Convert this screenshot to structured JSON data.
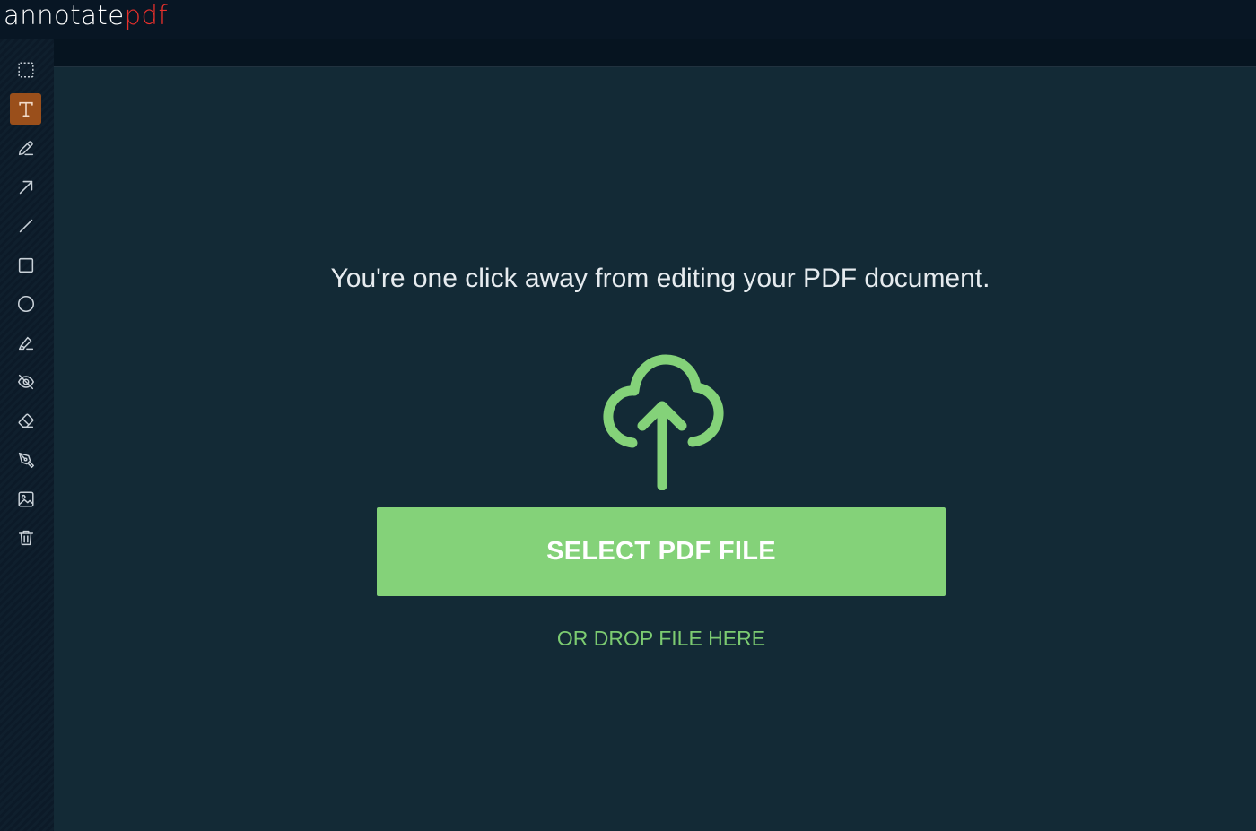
{
  "app": {
    "logo_part1": "annotate",
    "logo_part2": "pdf"
  },
  "colors": {
    "accent_green": "#84d279",
    "logo_red": "#e8302c",
    "active_tool": "#9a4f1b",
    "background": "#132a36"
  },
  "toolbar": {
    "tools": [
      {
        "icon": "select-region-icon",
        "active": false
      },
      {
        "icon": "text-icon",
        "active": true
      },
      {
        "icon": "pencil-icon",
        "active": false
      },
      {
        "icon": "arrow-icon",
        "active": false
      },
      {
        "icon": "line-icon",
        "active": false
      },
      {
        "icon": "rectangle-icon",
        "active": false
      },
      {
        "icon": "circle-icon",
        "active": false
      },
      {
        "icon": "highlighter-icon",
        "active": false
      },
      {
        "icon": "hide-eye-icon",
        "active": false
      },
      {
        "icon": "eraser-icon",
        "active": false
      },
      {
        "icon": "pen-nib-icon",
        "active": false
      },
      {
        "icon": "image-icon",
        "active": false
      },
      {
        "icon": "trash-icon",
        "active": false
      }
    ]
  },
  "upload": {
    "headline": "You're one click away from editing your PDF document.",
    "icon": "cloud-upload-icon",
    "select_button_label": "SELECT PDF FILE",
    "drop_text": "OR DROP FILE HERE"
  }
}
